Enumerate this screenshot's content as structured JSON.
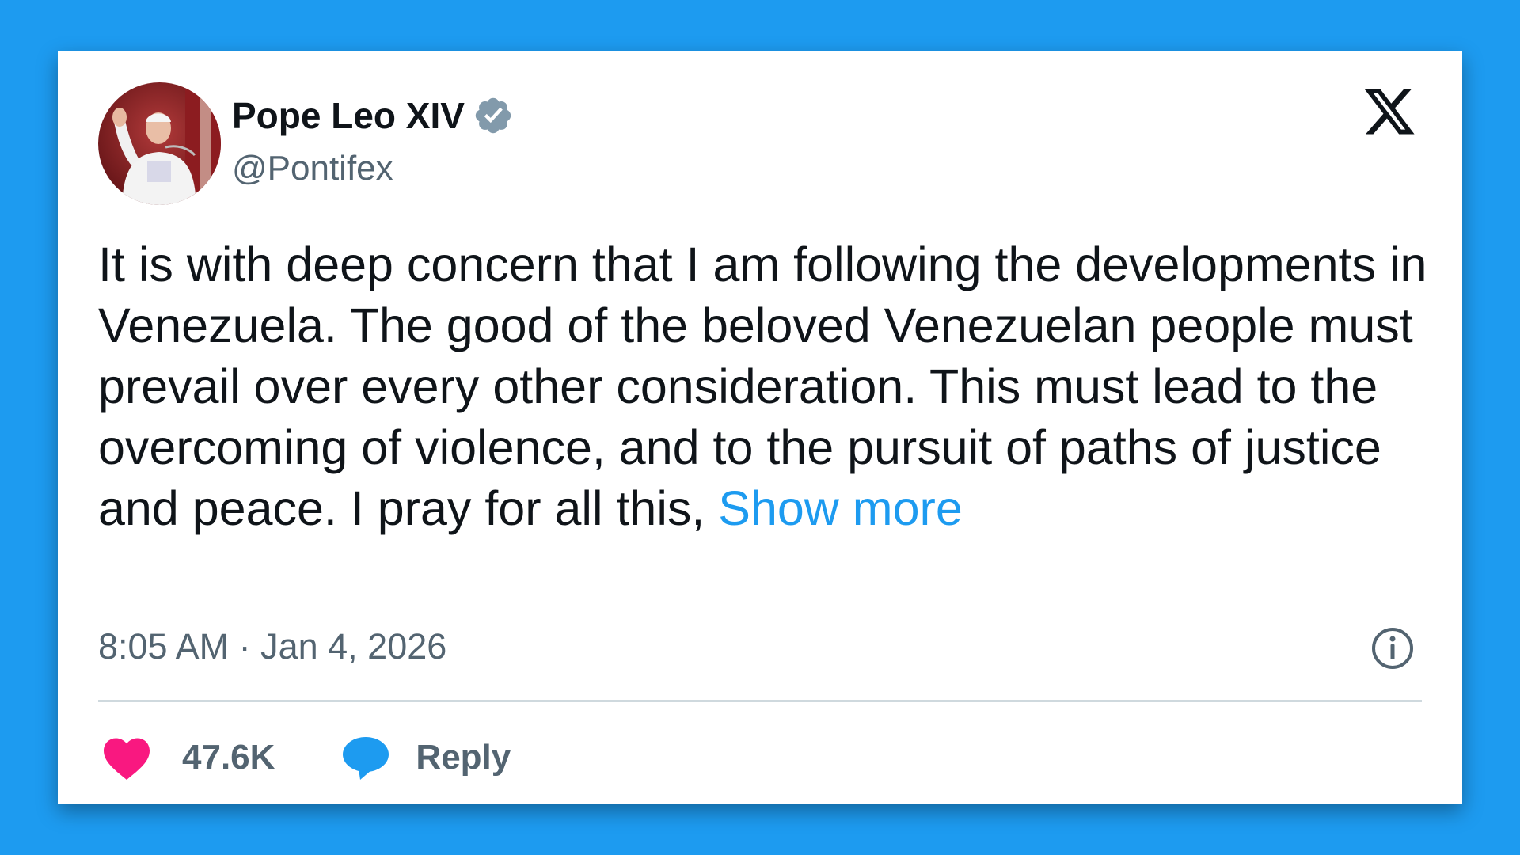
{
  "colors": {
    "background": "#1d9bf0",
    "link": "#1d9bf0",
    "heart": "#f91880",
    "text_primary": "#0f1419",
    "text_secondary": "#536471"
  },
  "author": {
    "display_name": "Pope Leo XIV",
    "handle": "@Pontifex",
    "verified": true
  },
  "icons": {
    "verified": "verified-badge-icon",
    "brand": "x-logo-icon",
    "info": "info-icon",
    "like": "heart-icon",
    "reply": "speech-bubble-icon"
  },
  "tweet": {
    "text": "It is with deep concern that I am following the developments in Venezuela. The good of the beloved Venezuelan people must prevail over every other consideration. This must lead to the overcoming of violence, and to the pursuit of paths of justice and peace. I pray for all this, ",
    "show_more": "Show more",
    "timestamp": "8:05 AM · Jan 4, 2026"
  },
  "actions": {
    "like_count": "47.6K",
    "reply_label": "Reply"
  }
}
